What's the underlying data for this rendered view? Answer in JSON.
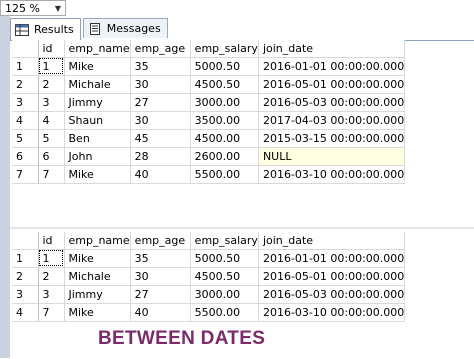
{
  "zoom": {
    "value": "125 %"
  },
  "tabs": [
    {
      "label": "Results",
      "icon": "results-grid-icon"
    },
    {
      "label": "Messages",
      "icon": "messages-icon"
    }
  ],
  "grid1": {
    "columns": [
      "id",
      "emp_name",
      "emp_age",
      "emp_salary",
      "join_date"
    ],
    "rows": [
      {
        "n": "1",
        "cells": [
          "1",
          "Mike",
          "35",
          "5000.50",
          "2016-01-01 00:00:00.000"
        ]
      },
      {
        "n": "2",
        "cells": [
          "2",
          "Michale",
          "30",
          "4500.50",
          "2016-05-01 00:00:00.000"
        ]
      },
      {
        "n": "3",
        "cells": [
          "3",
          "Jimmy",
          "27",
          "3000.00",
          "2016-05-03 00:00:00.000"
        ]
      },
      {
        "n": "4",
        "cells": [
          "4",
          "Shaun",
          "30",
          "3500.00",
          "2017-04-03 00:00:00.000"
        ]
      },
      {
        "n": "5",
        "cells": [
          "5",
          "Ben",
          "45",
          "4500.00",
          "2015-03-15 00:00:00.000"
        ]
      },
      {
        "n": "6",
        "cells": [
          "6",
          "John",
          "28",
          "2600.00",
          "NULL"
        ]
      },
      {
        "n": "7",
        "cells": [
          "7",
          "Mike",
          "40",
          "5500.00",
          "2016-03-10 00:00:00.000"
        ]
      }
    ]
  },
  "grid2": {
    "columns": [
      "id",
      "emp_name",
      "emp_age",
      "emp_salary",
      "join_date"
    ],
    "rows": [
      {
        "n": "1",
        "cells": [
          "1",
          "Mike",
          "35",
          "5000.50",
          "2016-01-01 00:00:00.000"
        ]
      },
      {
        "n": "2",
        "cells": [
          "2",
          "Michale",
          "30",
          "4500.50",
          "2016-05-01 00:00:00.000"
        ]
      },
      {
        "n": "3",
        "cells": [
          "3",
          "Jimmy",
          "27",
          "3000.00",
          "2016-05-03 00:00:00.000"
        ]
      },
      {
        "n": "4",
        "cells": [
          "7",
          "Mike",
          "40",
          "5500.00",
          "2016-03-10 00:00:00.000"
        ]
      }
    ]
  },
  "caption": "BETWEEN DATES",
  "colors": {
    "caption": "#7b2a6a",
    "null_cell": "#ffffe1"
  }
}
